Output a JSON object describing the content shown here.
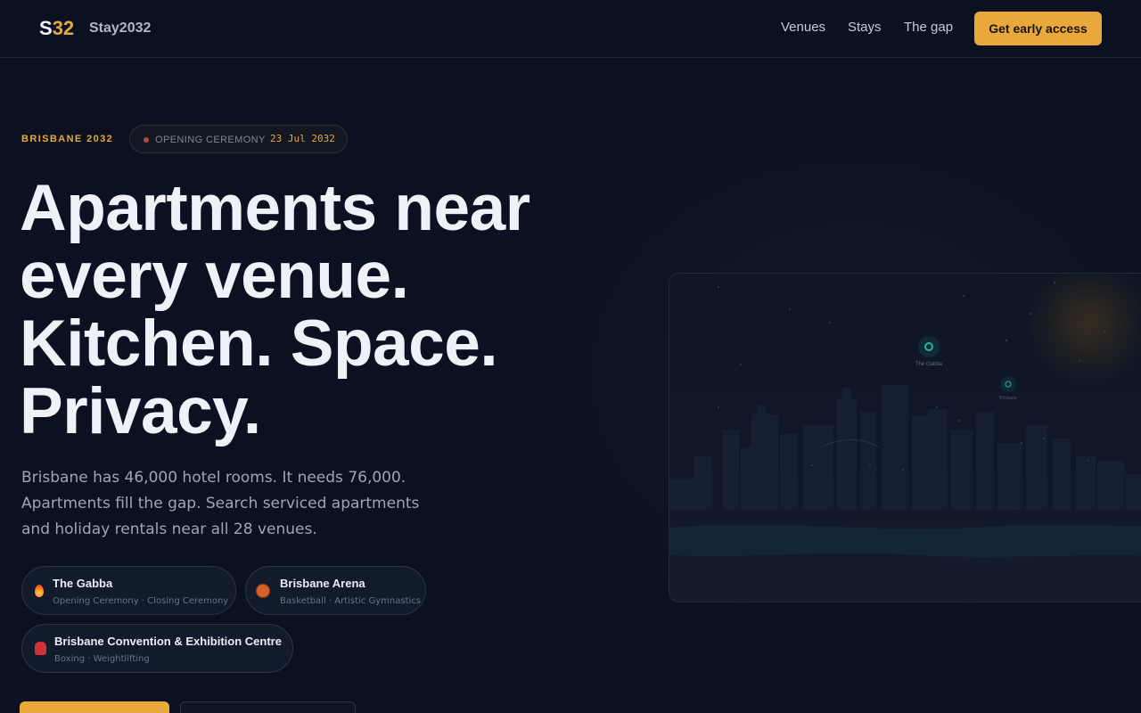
{
  "header": {
    "logo_s": "S",
    "logo_num": "32",
    "brand": "Stay2032",
    "nav": [
      "Venues",
      "Stays",
      "The gap"
    ],
    "cta": "Get early access"
  },
  "hero": {
    "eyebrow": "BRISBANE 2032",
    "pill_label": "OPENING CEREMONY",
    "pill_date": "23 Jul 2032",
    "headline": [
      "Apartments near",
      "every venue.",
      "Kitchen. Space.",
      "Privacy."
    ],
    "subtext": "Brisbane has 46,000 hotel rooms. It needs 76,000. Apartments fill the gap. Search serviced apartments and holiday rentals near all 28 venues."
  },
  "venues": [
    {
      "name": "The Gabba",
      "events": "Opening Ceremony · Closing Ceremony",
      "icon": "flame-icon"
    },
    {
      "name": "Brisbane Arena",
      "events": "Basketball · Artistic Gymnastics",
      "icon": "basketball-icon"
    },
    {
      "name": "Brisbane Convention & Exhibition Centre",
      "events": "Boxing · Weightlifting",
      "icon": "boxing-glove-icon"
    }
  ],
  "map": {
    "marker_1": "The Gabba",
    "marker_2": "Brisbane"
  },
  "colors": {
    "background": "#0b1120",
    "accent": "#e8a93a",
    "marker": "#2bb3a3"
  }
}
